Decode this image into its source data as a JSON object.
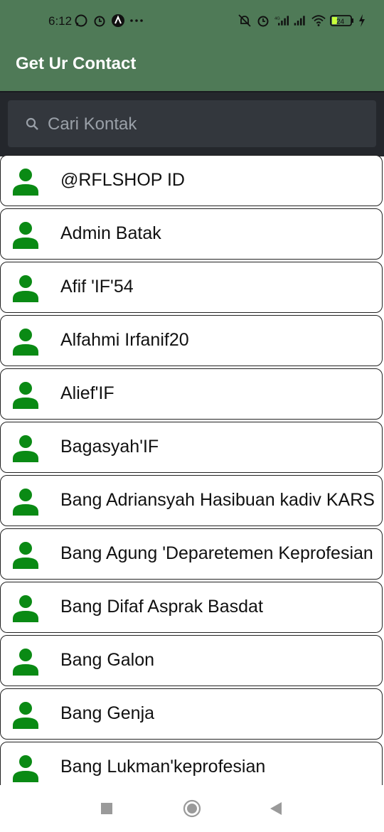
{
  "status_bar": {
    "time": "6:12",
    "battery": "24",
    "network": "4G",
    "icons": [
      "whatsapp-icon",
      "alarm-icon",
      "app-notification-icon",
      "more-icon",
      "mute-icon",
      "alarm-icon",
      "signal-icon",
      "signal-icon",
      "wifi-icon",
      "battery-icon",
      "charging-icon"
    ]
  },
  "app_bar": {
    "title": "Get Ur Contact",
    "color": "#4f7a57"
  },
  "search": {
    "placeholder": "Cari Kontak",
    "value": ""
  },
  "contacts": [
    {
      "name": "@RFLSHOP ID"
    },
    {
      "name": "Admin Batak"
    },
    {
      "name": "Afif 'IF'54"
    },
    {
      "name": "Alfahmi Irfanif20"
    },
    {
      "name": "Alief'IF"
    },
    {
      "name": "Bagasyah'IF"
    },
    {
      "name": "Bang Adriansyah Hasibuan kadiv KARS"
    },
    {
      "name": "Bang Agung 'Deparetemen Keprofesian"
    },
    {
      "name": "Bang Difaf Asprak Basdat"
    },
    {
      "name": "Bang Galon"
    },
    {
      "name": "Bang Genja"
    },
    {
      "name": "Bang Lukman'keprofesian"
    }
  ],
  "colors": {
    "person_icon": "#0a8a14",
    "search_bg": "#24272c"
  },
  "nav": {
    "buttons": [
      "recents-button",
      "home-button",
      "back-button"
    ]
  }
}
